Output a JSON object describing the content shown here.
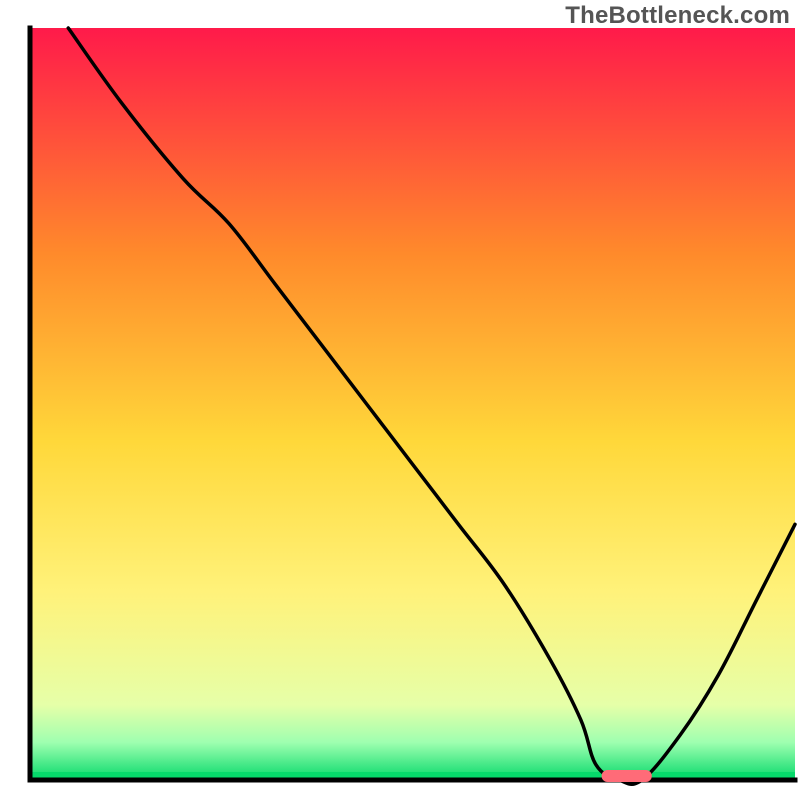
{
  "watermark": "TheBottleneck.com",
  "colors": {
    "grad_top": "#ff1a4a",
    "grad_mid_upper": "#ff8a2b",
    "grad_mid": "#ffd83a",
    "grad_mid_lower": "#fff27a",
    "grad_lower": "#e6ffa8",
    "grad_bottom_band": "#9fffb0",
    "grad_bottom_edge": "#06d96b",
    "axis": "#000000",
    "curve": "#000000",
    "marker": "#ff6b78"
  },
  "chart_data": {
    "type": "line",
    "title": "",
    "xlabel": "",
    "ylabel": "",
    "xlim": [
      0,
      100
    ],
    "ylim": [
      0,
      100
    ],
    "legend": false,
    "grid": false,
    "annotations": [
      {
        "label": "watermark",
        "text": "TheBottleneck.com",
        "position": "top-right"
      }
    ],
    "series": [
      {
        "name": "bottleneck-curve",
        "x": [
          5,
          12,
          20,
          26,
          32,
          38,
          44,
          50,
          56,
          62,
          68,
          72,
          74,
          77,
          80,
          85,
          90,
          95,
          100
        ],
        "y": [
          100,
          90,
          80,
          74,
          66,
          58,
          50,
          42,
          34,
          26,
          16,
          8,
          2,
          0,
          0,
          6,
          14,
          24,
          34
        ]
      }
    ],
    "marker": {
      "x": 78,
      "y": 0,
      "length_pct": 5
    },
    "background_gradient": {
      "stops": [
        {
          "offset": 0.0,
          "color": "#ff1a4a"
        },
        {
          "offset": 0.3,
          "color": "#ff8a2b"
        },
        {
          "offset": 0.55,
          "color": "#ffd83a"
        },
        {
          "offset": 0.75,
          "color": "#fff27a"
        },
        {
          "offset": 0.9,
          "color": "#e6ffa8"
        },
        {
          "offset": 0.95,
          "color": "#9fffb0"
        },
        {
          "offset": 1.0,
          "color": "#06d96b"
        }
      ]
    }
  }
}
